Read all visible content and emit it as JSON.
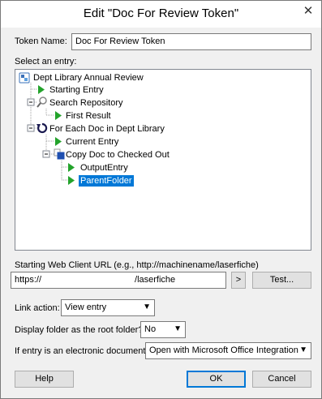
{
  "window": {
    "title": "Edit \"Doc For Review Token\"",
    "close": "✕"
  },
  "token_name": {
    "label": "Token Name:",
    "value": "Doc For Review Token"
  },
  "entry": {
    "label": "Select an entry:"
  },
  "tree": [
    {
      "label": "Dept Library Annual Review",
      "icon": "workflow-icon"
    },
    {
      "label": "Starting Entry",
      "icon": "play-icon"
    },
    {
      "label": "Search Repository",
      "icon": "search-icon"
    },
    {
      "label": "First Result",
      "icon": "play-icon"
    },
    {
      "label": "For Each Doc in  Dept Library",
      "icon": "loop-icon"
    },
    {
      "label": "Current Entry",
      "icon": "play-icon"
    },
    {
      "label": "Copy Doc to Checked Out",
      "icon": "copy-icon"
    },
    {
      "label": "OutputEntry",
      "icon": "play-icon"
    },
    {
      "label": "ParentFolder",
      "icon": "play-icon",
      "selected": true
    }
  ],
  "url": {
    "label": "Starting Web Client URL (e.g., http://machinename/laserfiche)",
    "value_prefix": "https://",
    "value_suffix": "/laserfiche",
    "go": ">",
    "test": "Test..."
  },
  "link_action": {
    "label": "Link action:",
    "value": "View entry"
  },
  "root_folder": {
    "label": "Display folder as the root folder?",
    "value": "No"
  },
  "electronic_doc": {
    "label": "If entry is an electronic document:",
    "value": "Open with Microsoft Office Integration"
  },
  "buttons": {
    "help": "Help",
    "ok": "OK",
    "cancel": "Cancel"
  },
  "colors": {
    "accent": "#0078d7",
    "play": "#23a32b"
  }
}
